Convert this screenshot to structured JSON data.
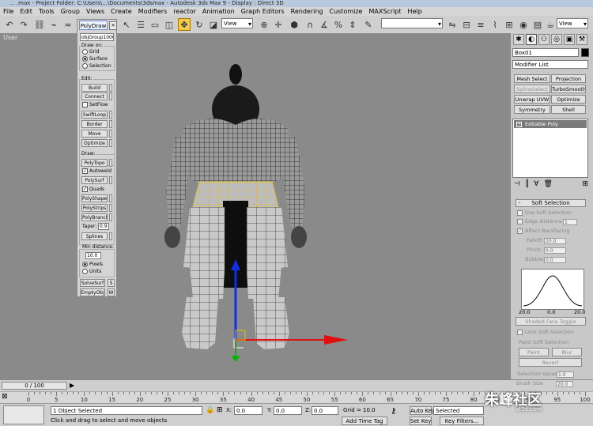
{
  "window": {
    "title": "... .max   -   Project Folder: C:\\Users\\...\\Documents\\3dsmax   -   Autodesk 3ds Max 9   -   Display : Direct 3D"
  },
  "menu": [
    "File",
    "Edit",
    "Tools",
    "Group",
    "Views",
    "Create",
    "Modifiers",
    "reactor",
    "Animation",
    "Graph Editors",
    "Rendering",
    "Customize",
    "MAXScript",
    "Help"
  ],
  "toolbar": {
    "ref_coord": "View",
    "view_combo": "View",
    "selection_set": ""
  },
  "viewport": {
    "label": "User"
  },
  "polydraw": {
    "tab": "PolyDraw",
    "close": "×",
    "object": "objGroup10001",
    "draw_on_label": "Draw on:",
    "draw_on": [
      "Grid",
      "Surface",
      "Selection"
    ],
    "edit_label": "Edit:",
    "build": "Build",
    "connect": "Connect",
    "setflow": "SetFlow",
    "swiftloop": "SwiftLoop",
    "border": "Border",
    "move": "Move",
    "optimize": "Optimize",
    "draw_label": "Draw:",
    "polytopo": "PolyTopo",
    "autoweld": "Autoweld",
    "polysurf": "PolySurf",
    "quads": "Quads",
    "polyshapes": "PolyShapes",
    "polystrips": "PolyStrips",
    "polybranch": "PolyBranch",
    "taper_label": "Taper:",
    "taper_value": "0.9",
    "splines": "Splines",
    "min_distance_label": "Min distance:",
    "min_distance_value": "10.0",
    "pixels": "Pixels",
    "units": "Units",
    "solvesurf": "SolveSurf",
    "solvesurf_s": "S",
    "emptyobj": "EmptyObj",
    "emptyobj_w": "W"
  },
  "command_panel": {
    "object_name": "Box01",
    "modifier_list": "Modifier List",
    "buttons": [
      "Mesh Select",
      "Projection",
      "SplineSelect",
      "TurboSmooth",
      "Unwrap UVW",
      "Optimize",
      "Symmetry",
      "Shell"
    ],
    "stack_item": "Editable Poly",
    "stack_toggle": "+",
    "soft_selection": "Soft Selection",
    "rollout_sign": "-",
    "use_soft_selection": "Use Soft Selection",
    "edge_distance": "Edge Distance",
    "edge_distance_value": "1",
    "affect_backfacing": "Affect Backfacing",
    "falloff_label": "Falloff:",
    "falloff_value": "20.0",
    "pinch_label": "Pinch:",
    "pinch_value": "0.0",
    "bubble_label": "Bubble:",
    "bubble_value": "0.0",
    "curve_left": "20.0",
    "curve_mid": "0.0",
    "curve_right": "20.0",
    "shaded_face_toggle": "Shaded Face Toggle",
    "lock_soft_selection": "Lock Soft Selection",
    "paint_soft_selection": "Paint Soft Selection",
    "paint": "Paint",
    "blur": "Blur",
    "revert": "Revert",
    "selection_value_label": "Selection Value",
    "selection_value": "1.0",
    "brush_size_label": "Brush Size",
    "brush_size": "20.0"
  },
  "timeline": {
    "slider": "0 / 100"
  },
  "trackbar": {
    "ticks": [
      "0",
      "5",
      "10",
      "15",
      "20",
      "25",
      "30",
      "35",
      "40",
      "45",
      "50",
      "55",
      "60",
      "65",
      "70",
      "75",
      "80",
      "85",
      "90",
      "95",
      "100"
    ]
  },
  "status": {
    "objects_selected": "1 Object Selected",
    "prompt": "Click and drag to select and move objects",
    "x_label": "X:",
    "x_value": "0.0",
    "y_label": "Y:",
    "y_value": "0.0",
    "z_label": "Z:",
    "z_value": "0.0",
    "grid": "Grid = 10.0",
    "add_time_tag": "Add Time Tag",
    "auto_key": "Auto Key",
    "set_key": "Set Key",
    "selected_combo": "Selected",
    "key_filters": "Key Filters..."
  },
  "watermark": {
    "main": "朱峰社区",
    "sub": "zf3d.com"
  },
  "colors": {
    "viewport_bg": "#8a8a8a",
    "axis_x": "#e01010",
    "axis_y": "#10b010",
    "axis_z": "#1030e0",
    "selection": "#f2c94c"
  }
}
